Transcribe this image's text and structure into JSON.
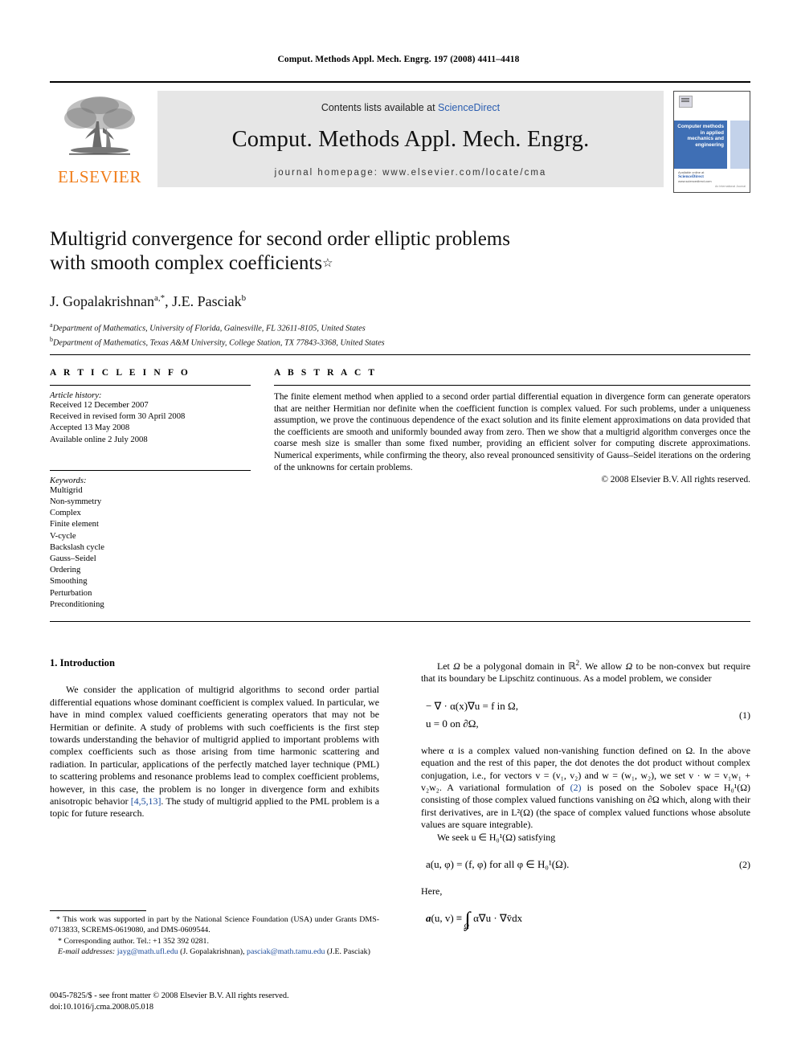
{
  "running_head": "Comput. Methods Appl. Mech. Engrg. 197 (2008) 4411–4418",
  "masthead": {
    "publisher_word": "ELSEVIER",
    "contents_prefix": "Contents lists available at ",
    "contents_link": "ScienceDirect",
    "journal_title": "Comput. Methods Appl. Mech. Engrg.",
    "homepage_line": "journal homepage: www.elsevier.com/locate/cma",
    "cover_title": "Computer methods in applied mechanics and engineering",
    "cover_available": "Available online at",
    "cover_sciencedirect": "ScienceDirect",
    "cover_url": "www.sciencedirect.com",
    "cover_footer_right": "An International Journal"
  },
  "title_block": {
    "title_line1": "Multigrid convergence for second order elliptic problems",
    "title_line2": "with smooth complex coefficients",
    "title_marker": "☆",
    "authors": "J. Gopalakrishnan",
    "author1_sup": "a,*",
    "authors_sep": ", J.E. Pasciak",
    "author2_sup": "b",
    "affiliation_a_sup": "a",
    "affiliation_a": "Department of Mathematics, University of Florida, Gainesville, FL 32611-8105, United States",
    "affiliation_b_sup": "b",
    "affiliation_b": "Department of Mathematics, Texas A&M University, College Station, TX 77843-3368, United States"
  },
  "article_info": {
    "heading": "A R T I C L E   I N F O",
    "history_label": "Article history:",
    "history": [
      "Received 12 December 2007",
      "Received in revised form 30 April 2008",
      "Accepted 13 May 2008",
      "Available online 2 July 2008"
    ],
    "keywords_label": "Keywords:",
    "keywords": [
      "Multigrid",
      "Non-symmetry",
      "Complex",
      "Finite element",
      "V-cycle",
      "Backslash cycle",
      "Gauss–Seidel",
      "Ordering",
      "Smoothing",
      "Perturbation",
      "Preconditioning"
    ]
  },
  "abstract": {
    "heading": "A B S T R A C T",
    "text": "The finite element method when applied to a second order partial differential equation in divergence form can generate operators that are neither Hermitian nor definite when the coefficient function is complex valued. For such problems, under a uniqueness assumption, we prove the continuous dependence of the exact solution and its finite element approximations on data provided that the coefficients are smooth and uniformly bounded away from zero. Then we show that a multigrid algorithm converges once the coarse mesh size is smaller than some fixed number, providing an efficient solver for computing discrete approximations. Numerical experiments, while confirming the theory, also reveal pronounced sensitivity of Gauss–Seidel iterations on the ordering of the unknowns for certain problems.",
    "copyright": "© 2008 Elsevier B.V. All rights reserved."
  },
  "body": {
    "section_heading": "1. Introduction",
    "left_para_1": "We consider the application of multigrid algorithms to second order partial differential equations whose dominant coefficient is complex valued. In particular, we have in mind complex valued coefficients generating operators that may not be Hermitian or definite. A study of problems with such coefficients is the first step towards understanding the behavior of multigrid applied to important problems with complex coefficients such as those arising from time harmonic scattering and radiation. In particular, applications of the perfectly matched layer technique (PML) to scattering problems and resonance problems lead to complex coefficient problems, however, in this case, the problem is no longer in divergence form and exhibits anisotropic behavior ",
    "left_citation": "[4,5,13]",
    "left_para_1_tail": ". The study of multigrid applied to the PML problem is a topic for future research.",
    "right_para_1_a": "Let ",
    "right_para_1_b": " be a polygonal domain in ",
    "right_para_1_c": ". We allow ",
    "right_para_1_d": " to be non-convex but require that its boundary be Lipschitz continuous. As a model problem, we consider",
    "eq1_line1": "− ∇ · α(x)∇u = f   in Ω,",
    "eq1_line2": "u = 0   on ∂Ω,",
    "eq1_number": "(1)",
    "right_para_2_a": "where α is a complex valued non-vanishing function defined on Ω. In the above equation and the rest of this paper, the dot denotes the dot product without complex conjugation, i.e., for vectors v = (v₁, v₂) and w = (w₁, w₂), we set v · w = v₁w₁ + v₂w₂. A variational formulation of ",
    "right_citation": "(2)",
    "right_para_2_b": " is posed on the Sobolev space H₀¹(Ω) consisting of those complex valued functions vanishing on ∂Ω which, along with their first derivatives, are in L²(Ω) (the space of complex valued functions whose absolute values are square integrable).",
    "right_para_3": "We seek u ∈ H₀¹(Ω) satisfying",
    "eq2_text": "a(u, φ) = (f, φ)   for all φ ∈ H₀¹(Ω).",
    "eq2_number": "(2)",
    "here_label": "Here,",
    "eq3_text": "a(u, v) ≡ ∫Ω α∇u · ∇v̄dx"
  },
  "footnotes": {
    "star_marker": "*",
    "star_text": "This work was supported in part by the National Science Foundation (USA) under Grants DMS-0713833, SCREMS-0619080, and DMS-0609544.",
    "corr_marker": "*",
    "corr_text": "Corresponding author. Tel.: +1 352 392 0281.",
    "email_label": "E-mail addresses:",
    "email1": "jayg@math.ufl.edu",
    "email1_name": "(J. Gopalakrishnan)",
    "email2": "pasciak@math.tamu.edu",
    "email2_name": "(J.E. Pasciak)"
  },
  "imprint": {
    "line1": "0045-7825/$ - see front matter © 2008 Elsevier B.V. All rights reserved.",
    "line2": "doi:10.1016/j.cma.2008.05.018"
  },
  "colors": {
    "link_blue": "#2a5db0",
    "ref_blue": "#18499b",
    "elsevier_orange": "#F07D1A",
    "band_grey": "#e6e6e6",
    "cover_blue": "#3f6fb5"
  }
}
